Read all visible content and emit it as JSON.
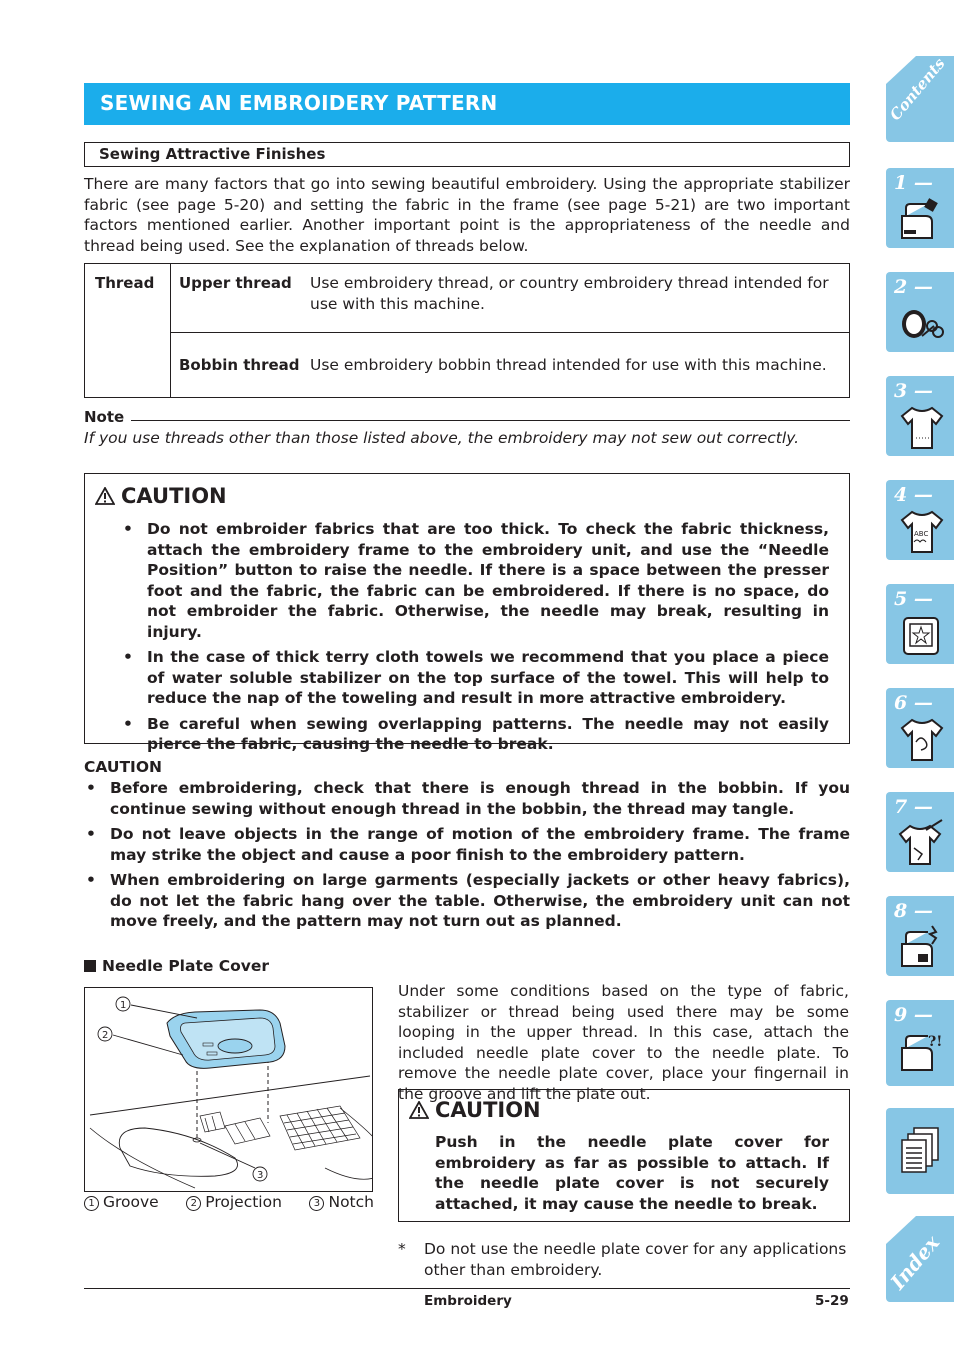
{
  "page": {
    "title": "SEWING AN EMBROIDERY PATTERN",
    "subheading": "Sewing Attractive Finishes",
    "intro": "There are many factors that go into sewing beautiful embroidery. Using the appropriate stabilizer fabric (see page 5-20) and setting the fabric in the frame (see page 5-21) are two important factors mentioned earlier. Another important point is the appropriateness of the needle and thread being used. See the explanation of threads below."
  },
  "thread_table": {
    "header": "Thread",
    "rows": [
      {
        "name": "Upper thread",
        "description": "Use embroidery thread, or country embroidery thread intended for use with this machine."
      },
      {
        "name": "Bobbin thread",
        "description": "Use embroidery bobbin thread intended for use with this machine."
      }
    ]
  },
  "note": {
    "label": "Note",
    "text": "If you use threads other than those listed above, the embroidery may not sew out correctly."
  },
  "caution_box_1": {
    "title": "CAUTION",
    "items": [
      "Do not embroider fabrics that are too thick. To check the fabric thickness, attach the embroidery frame to the embroidery unit, and use the “Needle Position” button to raise the needle. If there is a space between the presser foot and the fabric, the fabric can be embroidered. If there is no space, do not embroider the fabric. Otherwise, the needle may break, resulting in injury.",
      "In the case of thick terry cloth towels we recommend that you place a piece of water soluble stabilizer on the top surface of the towel. This will help to reduce the nap of the toweling and result in more attractive embroidery.",
      "Be careful when sewing overlapping patterns. The needle may not easily pierce the fabric, causing the needle to break."
    ]
  },
  "caution_2": {
    "label": "CAUTION",
    "items": [
      "Before embroidering, check that there is enough thread in the bobbin. If you continue sewing without enough thread in the bobbin, the thread may tangle.",
      "Do not leave objects in the range of motion of the embroidery frame. The frame may strike the object and cause a poor finish to the embroidery pattern.",
      "When embroidering on large garments (especially jackets or other heavy fabrics), do not let the fabric hang over the table. Otherwise, the embroidery unit can not move freely, and the pattern may not turn out as planned."
    ]
  },
  "needle_plate_cover": {
    "heading": "Needle Plate Cover",
    "text": "Under some conditions based on the type of fabric, stabilizer or thread being used there may be some looping in the upper thread. In this case, attach the included needle plate cover to the needle plate. To remove the needle plate cover, place your fingernail in the groove and lift the plate out.",
    "figure_labels": [
      {
        "num": "1",
        "label": "Groove"
      },
      {
        "num": "2",
        "label": "Projection"
      },
      {
        "num": "3",
        "label": "Notch"
      }
    ],
    "caution": {
      "title": "CAUTION",
      "text": "Push in the needle plate cover for embroidery as far as possible to attach. If the needle plate cover is not securely attached, it may cause the needle to break."
    },
    "footnote_mark": "*",
    "footnote": "Do not use the needle plate cover for any applications other than embroidery."
  },
  "footer": {
    "section": "Embroidery",
    "page": "5-29"
  },
  "sidebar": {
    "contents": "Contents",
    "index": "Index",
    "tabs": [
      {
        "num": "1 —",
        "icon": "sewing-machine-icon"
      },
      {
        "num": "2 —",
        "icon": "thread-spool-scissors-icon"
      },
      {
        "num": "3 —",
        "icon": "shirt-dotted-icon"
      },
      {
        "num": "4 —",
        "icon": "shirt-abc-icon"
      },
      {
        "num": "5 —",
        "icon": "embroidery-frame-icon"
      },
      {
        "num": "6 —",
        "icon": "shirt-design-icon"
      },
      {
        "num": "7 —",
        "icon": "shirt-repair-icon"
      },
      {
        "num": "8 —",
        "icon": "machine-maintenance-icon"
      },
      {
        "num": "9 —",
        "icon": "machine-troubleshoot-icon"
      },
      {
        "num": "",
        "icon": "documents-icon"
      }
    ],
    "colors": {
      "tab": "#87c6e5",
      "title_bar": "#1badeb"
    }
  }
}
